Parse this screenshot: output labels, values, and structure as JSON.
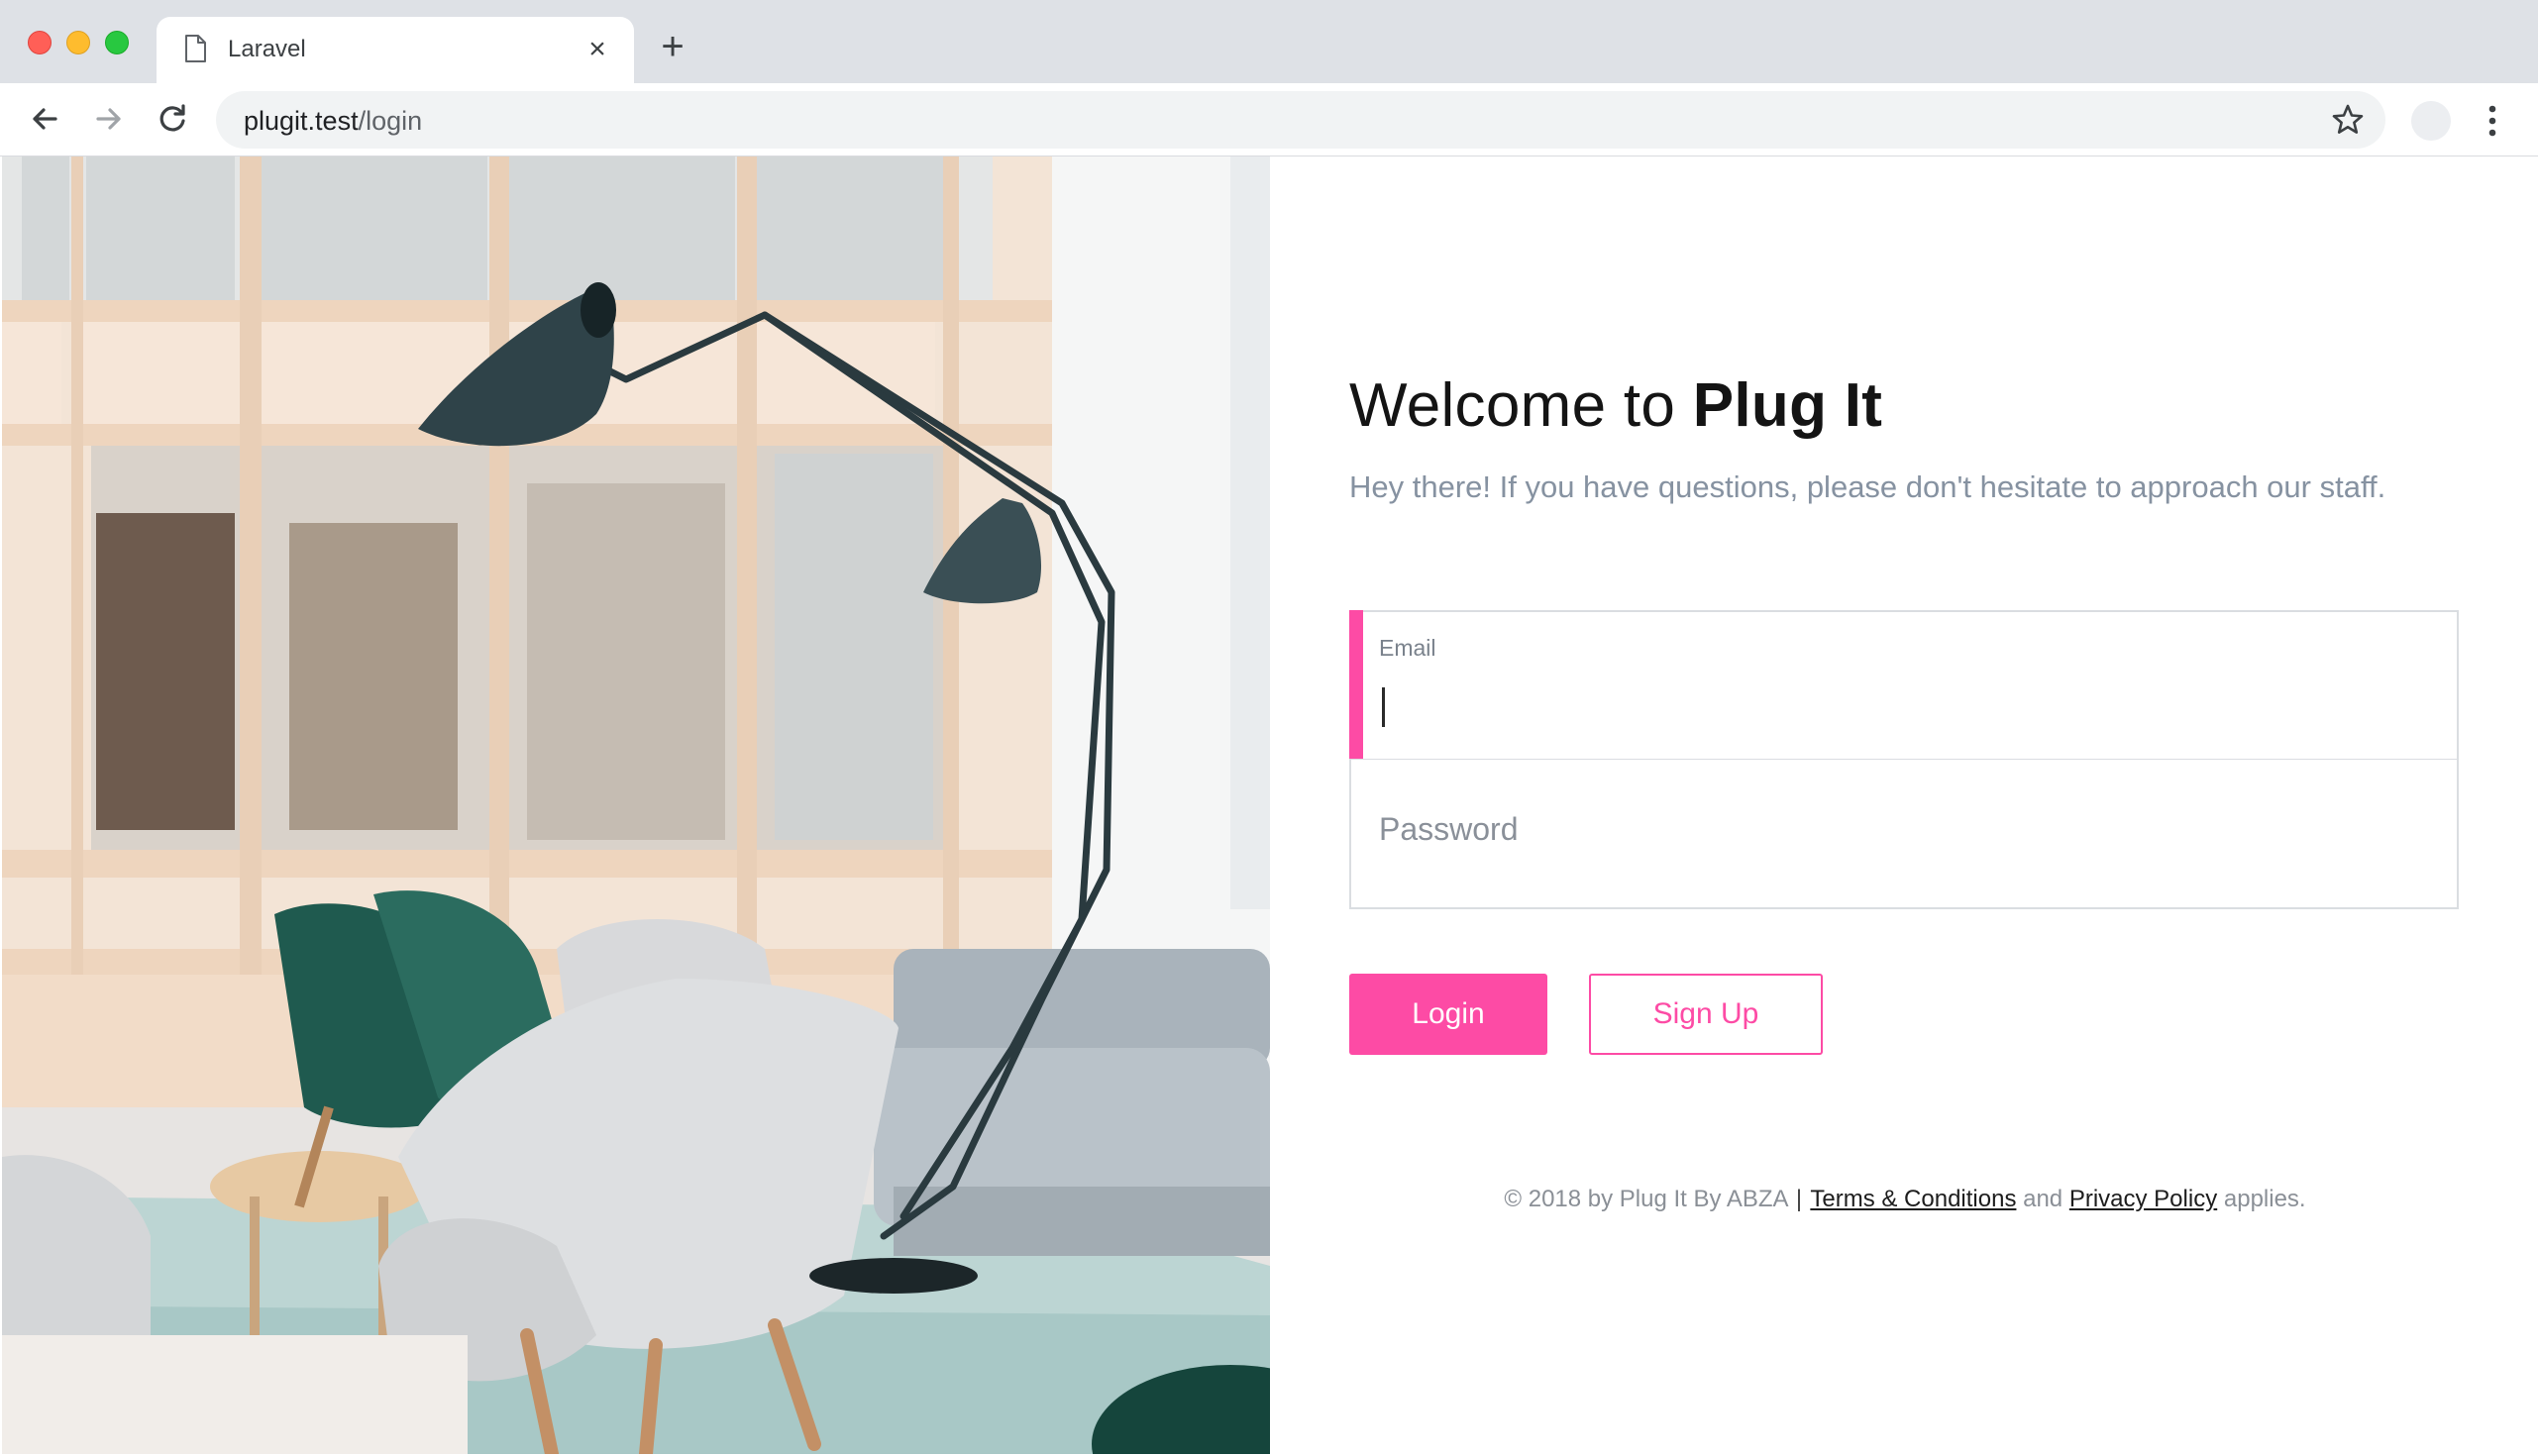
{
  "browser": {
    "tab_title": "Laravel",
    "new_tab_symbol": "+",
    "close_symbol": "×",
    "url_host": "plugit.test",
    "url_path": "/login"
  },
  "hero": {
    "image_subject": "lounge interior with floor lamp, green and grey chairs, sofa"
  },
  "login": {
    "welcome_prefix": "Welcome to ",
    "brand": "Plug It",
    "subtitle": "Hey there! If you have questions, please don't hesitate to approach our staff.",
    "email_label": "Email",
    "email_value": "",
    "password_placeholder": "Password",
    "login_button": "Login",
    "signup_button": "Sign Up"
  },
  "footer": {
    "copyright": "© 2018 by Plug It By ABZA",
    "separator": "|",
    "terms_link": "Terms & Conditions",
    "and_text": "and",
    "privacy_link": "Privacy Policy",
    "applies_text": "applies."
  },
  "colors": {
    "accent": "#fd4ba5",
    "subtitle_text": "#8692a1",
    "chrome_bg": "#dee1e6"
  },
  "icons": {
    "tab": "document-icon",
    "back": "arrow-left-icon",
    "forward": "arrow-right-icon",
    "reload": "reload-icon",
    "bookmark": "star-icon",
    "profile": "avatar-icon",
    "menu": "kebab-menu-icon"
  }
}
